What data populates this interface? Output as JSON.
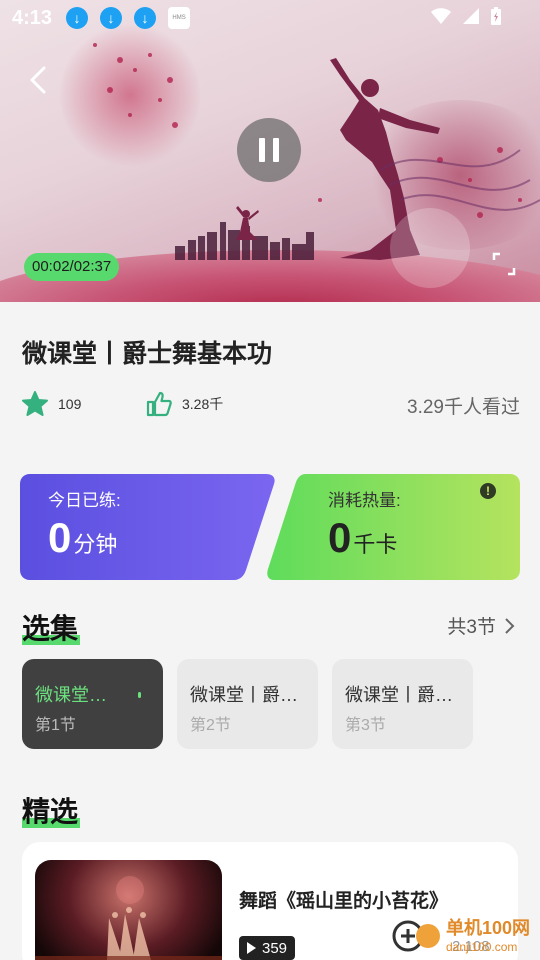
{
  "status": {
    "time": "4:13",
    "hms": "HMS"
  },
  "player": {
    "time": "00:02/02:37"
  },
  "course": {
    "title": "微课堂丨爵士舞基本功",
    "favorites": "109",
    "likes": "3.28千",
    "views": "3.29千人看过"
  },
  "stats_cards": {
    "today": {
      "label": "今日已练:",
      "value": "0",
      "unit": "分钟"
    },
    "calories": {
      "label": "消耗热量:",
      "value": "0",
      "unit": "千卡"
    }
  },
  "episodes_section": {
    "title": "选集",
    "more": "共3节",
    "items": [
      {
        "title": "微课堂…",
        "index": "第1节",
        "active": true
      },
      {
        "title": "微课堂丨爵…",
        "index": "第2节",
        "active": false
      },
      {
        "title": "微课堂丨爵…",
        "index": "第3节",
        "active": false
      }
    ]
  },
  "featured_section": {
    "title": "精选",
    "items": [
      {
        "title": "舞蹈《瑶山里的小苔花》",
        "plays": "359",
        "extra": "2.108"
      }
    ]
  },
  "watermark": {
    "line1": "单机100网",
    "line2": "danji100.com"
  },
  "colors": {
    "accent_green": "#57d96e",
    "purple": "#6b5ce7",
    "lime": "#a6e35c"
  }
}
